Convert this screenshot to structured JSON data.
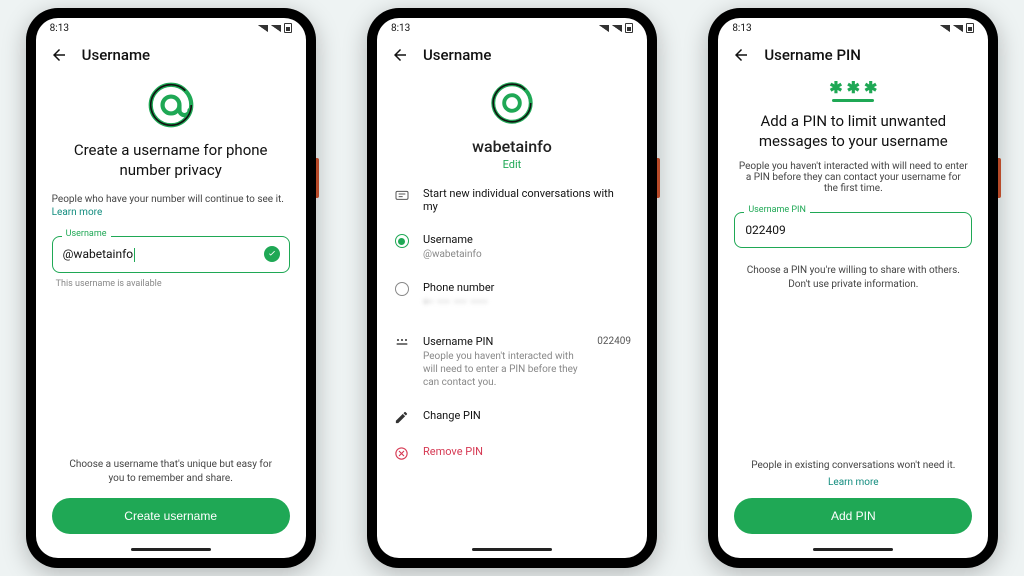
{
  "status_time": "8:13",
  "screen1": {
    "title": "Username",
    "hero": "Create a username for phone number privacy",
    "sub": "People who have your number will continue to see it.",
    "learn": "Learn more",
    "field_label": "Username",
    "field_value": "@wabetainfo",
    "hint": "This username is available",
    "bottom": "Choose a username that's unique but easy for you to remember and share.",
    "cta": "Create username"
  },
  "screen2": {
    "title": "Username",
    "name": "wabetainfo",
    "edit": "Edit",
    "section_label": "Start new individual conversations with my",
    "opt_username": "Username",
    "opt_username_sub": "@wabetainfo",
    "opt_phone": "Phone number",
    "opt_phone_sub": "+• ••• ••• ••••",
    "pin_row_title": "Username PIN",
    "pin_row_sub": "People you haven't interacted with will need to enter a PIN before they can contact you.",
    "pin_value": "022409",
    "change_pin": "Change PIN",
    "remove_pin": "Remove PIN"
  },
  "screen3": {
    "title": "Username PIN",
    "hero": "Add a PIN to limit unwanted messages to your username",
    "sub": "People you haven't interacted with will need to enter a PIN before they can contact your username for the first time.",
    "field_label": "Username PIN",
    "field_value": "022409",
    "mid_note": "Choose a PIN you're willing to share with others. Don't use private information.",
    "bottom": "People in existing conversations won't need it.",
    "learn": "Learn more",
    "cta": "Add PIN"
  }
}
